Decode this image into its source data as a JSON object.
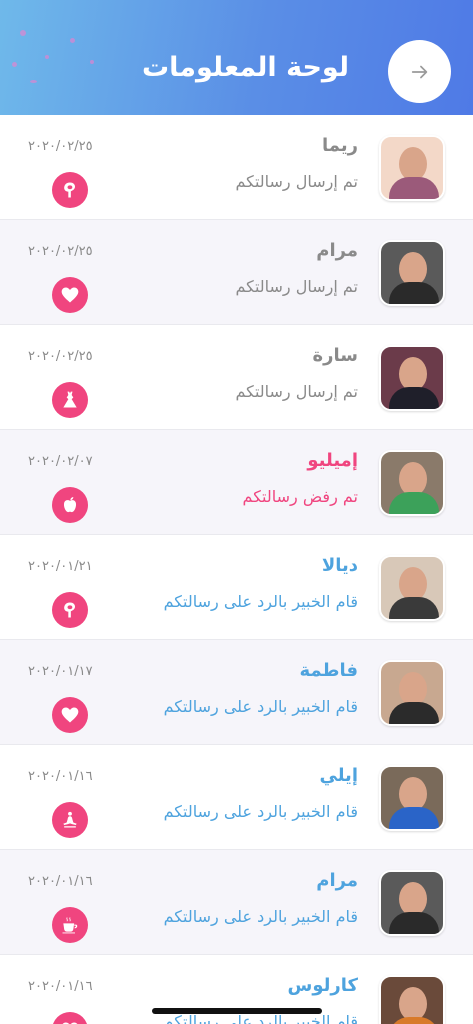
{
  "header": {
    "title": "لوحة المعلومات",
    "back_icon": "arrow-right-icon"
  },
  "colors": {
    "sent": "#8a8a8a",
    "rejected": "#f0457f",
    "replied": "#4ea3de",
    "badge": "#f0457f"
  },
  "rows": [
    {
      "name": "ريما",
      "status": "تم إرسال رسالتكم",
      "date": "٢٠٢٠/٠٢/٢٥",
      "state": "sent",
      "icon": "uterus-icon"
    },
    {
      "name": "مرام",
      "status": "تم إرسال رسالتكم",
      "date": "٢٠٢٠/٠٢/٢٥",
      "state": "sent",
      "icon": "heart-icon"
    },
    {
      "name": "سارة",
      "status": "تم إرسال رسالتكم",
      "date": "٢٠٢٠/٠٢/٢٥",
      "state": "sent",
      "icon": "dress-icon"
    },
    {
      "name": "إميليو",
      "status": "تم رفض رسالتكم",
      "date": "٢٠٢٠/٠٢/٠٧",
      "state": "rejected",
      "icon": "apple-icon"
    },
    {
      "name": "ديالا",
      "status": "قام الخبير بالرد على رسالتكم",
      "date": "٢٠٢٠/٠١/٢١",
      "state": "replied",
      "icon": "uterus-icon"
    },
    {
      "name": "فاطمة",
      "status": "قام الخبير بالرد على رسالتكم",
      "date": "٢٠٢٠/٠١/١٧",
      "state": "replied",
      "icon": "heart-icon"
    },
    {
      "name": "إيلي",
      "status": "قام الخبير بالرد على رسالتكم",
      "date": "٢٠٢٠/٠١/١٦",
      "state": "replied",
      "icon": "meditation-icon"
    },
    {
      "name": "مرام",
      "status": "قام الخبير بالرد على رسالتكم",
      "date": "٢٠٢٠/٠١/١٦",
      "state": "replied",
      "icon": "coffee-cup-icon"
    },
    {
      "name": "كارلوس",
      "status": "قام الخبير بالرد على رسالتكم",
      "date": "٢٠٢٠/٠١/١٦",
      "state": "replied",
      "icon": "heart-icon"
    }
  ]
}
